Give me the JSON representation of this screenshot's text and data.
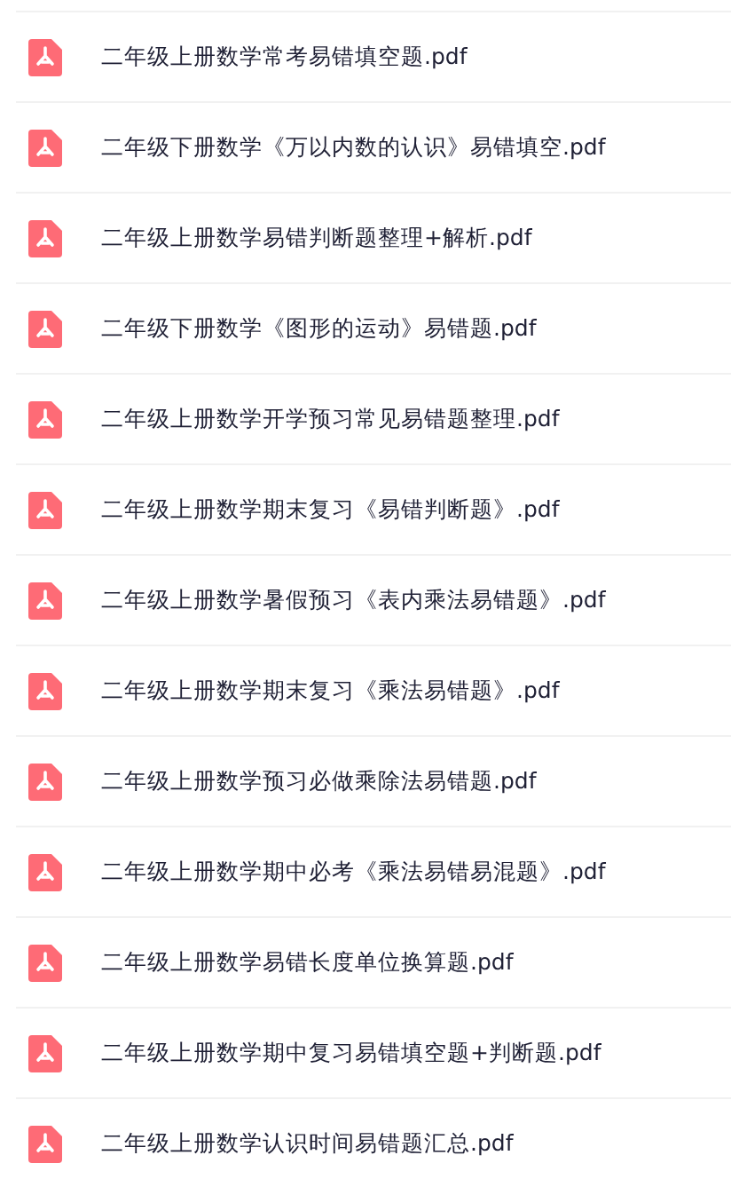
{
  "files": [
    {
      "name": "二年级上册数学常考易错填空题.pdf"
    },
    {
      "name": "二年级下册数学《万以内数的认识》易错填空.pdf"
    },
    {
      "name": "二年级上册数学易错判断题整理+解析.pdf"
    },
    {
      "name": "二年级下册数学《图形的运动》易错题.pdf"
    },
    {
      "name": "二年级上册数学开学预习常见易错题整理.pdf"
    },
    {
      "name": "二年级上册数学期末复习《易错判断题》.pdf"
    },
    {
      "name": "二年级上册数学暑假预习《表内乘法易错题》.pdf"
    },
    {
      "name": "二年级上册数学期末复习《乘法易错题》.pdf"
    },
    {
      "name": "二年级上册数学预习必做乘除法易错题.pdf"
    },
    {
      "name": "二年级上册数学期中必考《乘法易错易混题》.pdf"
    },
    {
      "name": "二年级上册数学易错长度单位换算题.pdf"
    },
    {
      "name": "二年级上册数学期中复习易错填空题+判断题.pdf"
    },
    {
      "name": "二年级上册数学认识时间易错题汇总.pdf"
    }
  ]
}
